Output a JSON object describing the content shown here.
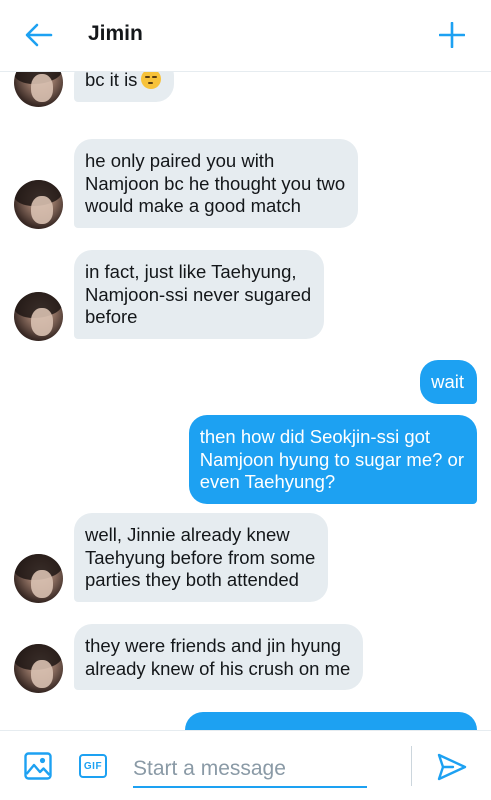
{
  "header": {
    "title": "Jimin",
    "back_icon": "arrow-left-icon",
    "add_icon": "plus-icon"
  },
  "messages": [
    {
      "direction": "incoming",
      "lines": [
        "bc it is"
      ],
      "emoji": "pensive-face-emoji"
    },
    {
      "direction": "incoming",
      "lines": [
        "he only paired you with",
        "Namjoon bc he thought you two",
        "would make a good match"
      ]
    },
    {
      "direction": "incoming",
      "lines": [
        "in fact, just like Taehyung,",
        "Namjoon-ssi never sugared",
        "before"
      ]
    },
    {
      "direction": "outgoing",
      "lines": [
        "wait"
      ]
    },
    {
      "direction": "outgoing",
      "lines": [
        "then how did Seokjin-ssi got",
        "Namjoon hyung to sugar me? or",
        "even Taehyung?"
      ]
    },
    {
      "direction": "incoming",
      "lines": [
        "well, Jinnie already knew",
        "Taehyung before from some",
        "parties they both attended"
      ]
    },
    {
      "direction": "incoming",
      "lines": [
        "they were friends and jin hyung",
        "already knew of his crush on me"
      ]
    },
    {
      "direction": "outgoing",
      "lines": [
        ""
      ]
    }
  ],
  "composer": {
    "placeholder": "Start a message",
    "gif_label": "GIF",
    "media_icon": "image-icon",
    "send_icon": "send-icon"
  },
  "colors": {
    "accent": "#1da1f2",
    "incoming_bubble": "#e6ecf0",
    "text": "#14171a"
  }
}
